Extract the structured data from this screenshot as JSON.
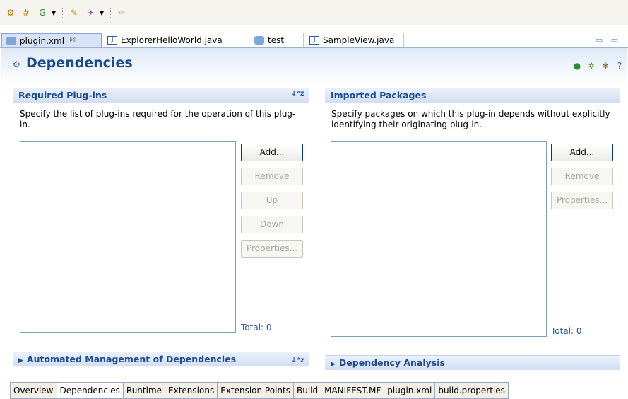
{
  "toolbar": {
    "icons": [
      "plugin-wizard-icon",
      "grid-plugin-icon",
      "run-icon",
      "dropdown-icon",
      "open-folder-icon",
      "tool-icon",
      "dropdown-icon",
      "pencil-icon"
    ]
  },
  "editor_tabs": [
    {
      "label": "plugin.xml",
      "close": "☒",
      "active": true
    },
    {
      "label": "ExplorerHelloWorld.java",
      "active": false
    },
    {
      "label": "test",
      "active": false
    },
    {
      "label": "SampleView.java",
      "active": false
    }
  ],
  "window_controls": "▭ ▭",
  "header": {
    "title": "Dependencies"
  },
  "required": {
    "title": "Required Plug-ins",
    "description": "Specify the list of plug-ins required for the operation of this plug-in.",
    "buttons": {
      "add": "Add...",
      "remove": "Remove",
      "up": "Up",
      "down": "Down",
      "properties": "Properties..."
    },
    "total": "Total: 0"
  },
  "imported": {
    "title": "Imported Packages",
    "description": "Specify packages on which this plug-in depends without explicitly identifying their originating plug-in.",
    "buttons": {
      "add": "Add...",
      "remove": "Remove",
      "properties": "Properties..."
    },
    "total": "Total: 0"
  },
  "automated": {
    "title": "Automated Management of Dependencies"
  },
  "analysis": {
    "title": "Dependency Analysis"
  },
  "bottom_tabs": [
    "Overview",
    "Dependencies",
    "Runtime",
    "Extensions",
    "Extension Points",
    "Build",
    "MANIFEST.MF",
    "plugin.xml",
    "build.properties"
  ],
  "active_bottom_tab": "Dependencies",
  "colors": {
    "accent": "#1f4b92",
    "link": "#2b5aa5"
  }
}
